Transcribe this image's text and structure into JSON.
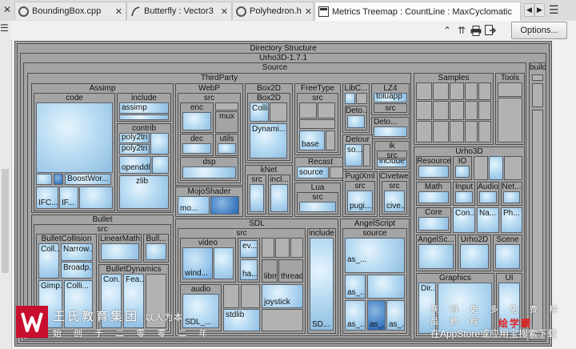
{
  "tabs": [
    {
      "label": "BoundingBox.cpp",
      "icon": "cpp-file-icon"
    },
    {
      "label": "Butterfly : Vector3",
      "icon": "graph-icon"
    },
    {
      "label": "Polyhedron.h",
      "icon": "header-file-icon"
    },
    {
      "label": "Metrics Treemap : CountLine : MaxCyclomatic",
      "icon": "treemap-icon",
      "active": true
    }
  ],
  "toolbar": {
    "options_label": "Options..."
  },
  "treemap": {
    "directory_structure": "Directory Structure",
    "root": "Urho3D-1.7.1",
    "source": "Source",
    "build": "build",
    "thirdparty": "ThirdParty",
    "samples": "Samples",
    "tools": "Tools",
    "assimp": {
      "title": "Assimp",
      "code": "code",
      "include": "include",
      "assimp": "assimp",
      "contrib": "contrib",
      "poly2tri_a": "poly2tri",
      "poly2tri_b": "poly2tri",
      "openddl": "openddl...",
      "zlib": "zlib",
      "boostwor": "BoostWor...",
      "ifc1": "IFC...",
      "ifc2": "IF..."
    },
    "webp": {
      "title": "WebP",
      "src": "src",
      "enc": "enc",
      "mux": "mux",
      "dec": "dec",
      "utils": "utils",
      "dsp": "dsp"
    },
    "box2d": {
      "title": "Box2D",
      "inner": "Box2D",
      "colli": "Colli...",
      "dynami": "Dynami..."
    },
    "freetype": {
      "title": "FreeType",
      "src": "src",
      "base": "base"
    },
    "libc": {
      "title": "LibC...",
      "src": "src",
      "deto": "Deto..."
    },
    "lz4": {
      "title": "LZ4",
      "toluapp": "toluapp",
      "src": "src",
      "deto": "Deto..."
    },
    "detour": {
      "title": "Detour",
      "so": "so..."
    },
    "ik": {
      "title": "ik",
      "src": "src",
      "include": "include"
    },
    "recast": {
      "title": "Recast",
      "source": "source"
    },
    "knet": {
      "title": "kNet",
      "src": "src",
      "incl": "incl..."
    },
    "mojoshader": {
      "title": "MojoShader",
      "mo": "mo..."
    },
    "lua": {
      "title": "Lua",
      "src": "src"
    },
    "pugixml": {
      "title": "PugiXml",
      "src": "src",
      "pugi": "pugi..."
    },
    "civetweb": {
      "title": "Civetweb",
      "src": "src",
      "cive": "cive..."
    },
    "bullet": {
      "title": "Bullet",
      "src": "src",
      "collision": "BulletCollision",
      "coll": "Coll...",
      "narrow": "Narrow...",
      "broadp": "Broadp...",
      "gimp": "Gimp...",
      "colli": "Colli...",
      "linearmath": "LinearMath",
      "bull": "Bull...",
      "dynamics": "BulletDynamics",
      "con": "Con...",
      "fea": "Fea..."
    },
    "sdl": {
      "title": "SDL",
      "src": "src",
      "include": "include",
      "video": "video",
      "wind": "wind...",
      "ev": "ev...",
      "ha": "ha...",
      "audio": "audio",
      "sdl_": "SDL_...",
      "stdlib": "stdlib",
      "libm": "libm",
      "thread": "thread",
      "joystick": "joystick",
      "sd": "SD..."
    },
    "angelscript": {
      "title": "AngelScript",
      "source": "source",
      "as1": "as_...",
      "as2": "as_...",
      "as3": "as_...",
      "as4": "as_...",
      "as5": "as_..."
    },
    "urho3d": {
      "title": "Urho3D",
      "resource": "Resource",
      "io": "IO",
      "math": "Math",
      "input": "Input",
      "audio": "Audio",
      "net": "Net...",
      "core": "Core",
      "con": "Con...",
      "na": "Na...",
      "ph": "Ph...",
      "angelsc": "AngelSc...",
      "urho2d": "Urho2D",
      "scene": "Scene",
      "graphics": "Graphics",
      "ui": "UI",
      "dir": "Dir..."
    }
  },
  "watermark": {
    "company": "王氏教育集团",
    "motto": "以人为本",
    "founded": "始 创 于 二 零 零 二 年",
    "promo": "获 得 更 多 免 费 精 品 教 程",
    "app": "绘学霸",
    "store_prefix": "在AppStore或应用宝",
    "store_suffix": "搜索下载"
  }
}
